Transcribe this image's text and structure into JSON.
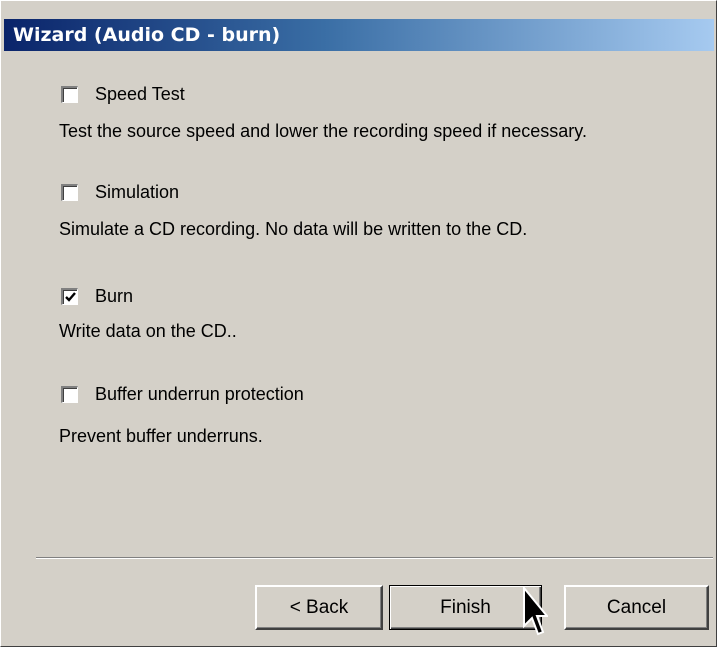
{
  "window": {
    "title": "Wizard (Audio CD - burn)"
  },
  "options": [
    {
      "label": "Speed Test",
      "checked": false,
      "description": "Test the source speed and lower the recording speed if necessary."
    },
    {
      "label": "Simulation",
      "checked": false,
      "description": "Simulate a CD recording. No data will be written to the CD."
    },
    {
      "label": "Burn",
      "checked": true,
      "description": "Write data on the CD.."
    },
    {
      "label": "Buffer underrun protection",
      "checked": false,
      "description": "Prevent buffer underruns."
    }
  ],
  "buttons": {
    "back": "< Back",
    "finish": "Finish",
    "cancel": "Cancel"
  },
  "colors": {
    "dialog_face": "#d4d0c8",
    "title_gradient_start": "#0a246a",
    "title_gradient_end": "#a6caf0",
    "title_text": "#ffffff"
  },
  "icons": {
    "cursor": "arrow-cursor-icon",
    "checkmark": "checkmark-icon"
  }
}
